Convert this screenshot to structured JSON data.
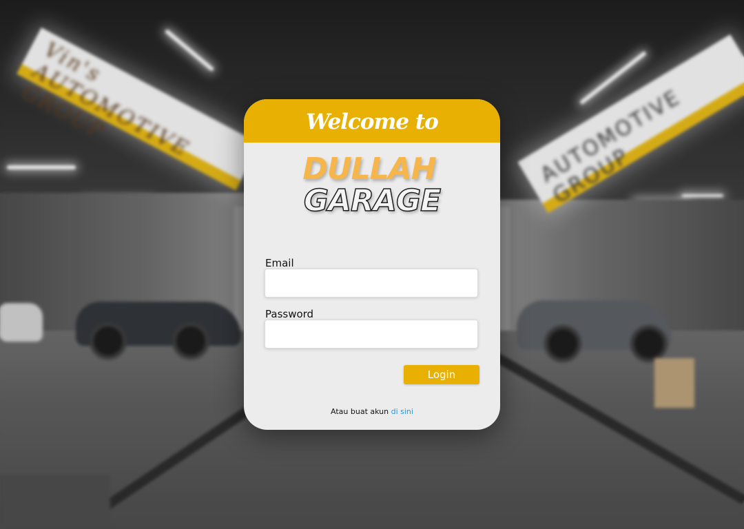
{
  "header": {
    "welcome": "Welcome to"
  },
  "logo": {
    "line1": "DULLAH",
    "line2": "GARAGE"
  },
  "form": {
    "email_label": "Email",
    "email_value": "",
    "email_placeholder": "",
    "password_label": "Password",
    "password_value": "",
    "password_placeholder": "",
    "login_label": "Login"
  },
  "footer": {
    "text": "Atau buat akun",
    "link": "di sini"
  },
  "background_signs": {
    "left": "Vin's AUTOMOTIVE GROUP",
    "right": "AUTOMOTIVE GROUP"
  },
  "colors": {
    "accent": "#e9b004",
    "card_bg": "#ececec",
    "logo_orange": "#f6b64c",
    "link": "#1e9be6"
  }
}
